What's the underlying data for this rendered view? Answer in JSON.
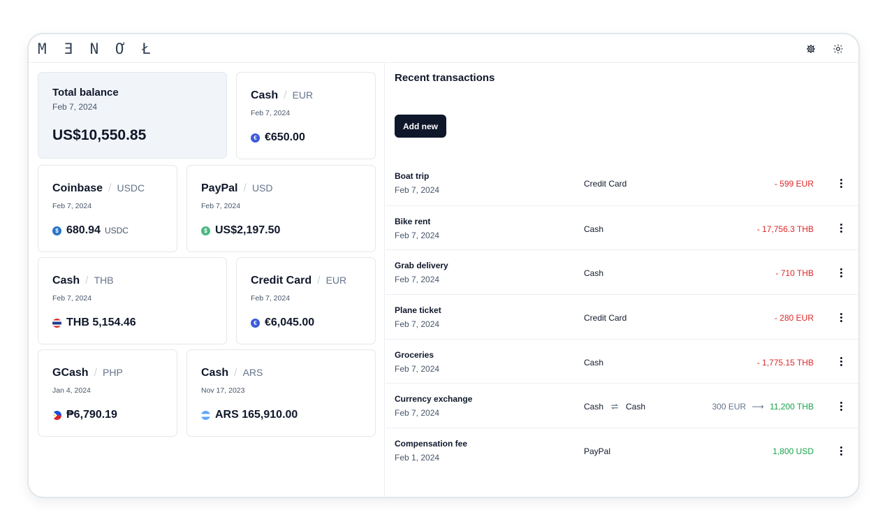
{
  "app": {
    "logo": "M Ǝ N Ơ Ł"
  },
  "header": {
    "settings_icon": "gear-icon",
    "theme_icon": "sun-icon"
  },
  "accounts": {
    "total": {
      "title": "Total balance",
      "date": "Feb 7, 2024",
      "amount": "US$10,550.85"
    },
    "cash_eur": {
      "name": "Cash",
      "currency": "EUR",
      "date": "Feb 7, 2024",
      "amount": "€650.00",
      "icon": "euro-icon",
      "icon_color": "#3b5bdb"
    },
    "coinbase": {
      "name": "Coinbase",
      "currency": "USDC",
      "date": "Feb 7, 2024",
      "amount": "680.94",
      "unit": "USDC",
      "icon": "usdc-icon",
      "icon_color": "#2775ca"
    },
    "paypal": {
      "name": "PayPal",
      "currency": "USD",
      "date": "Feb 7, 2024",
      "amount": "US$2,197.50",
      "icon": "dollar-icon",
      "icon_color": "#4cb782"
    },
    "cash_thb": {
      "name": "Cash",
      "currency": "THB",
      "date": "Feb 7, 2024",
      "amount": "THB 5,154.46",
      "icon": "thailand-flag-icon"
    },
    "credit_card": {
      "name": "Credit Card",
      "currency": "EUR",
      "date": "Feb 7, 2024",
      "amount": "€6,045.00",
      "icon": "euro-icon",
      "icon_color": "#3b5bdb"
    },
    "gcash": {
      "name": "GCash",
      "currency": "PHP",
      "date": "Jan 4, 2024",
      "amount": "₱6,790.19",
      "icon": "philippines-flag-icon"
    },
    "cash_ars": {
      "name": "Cash",
      "currency": "ARS",
      "date": "Nov 17, 2023",
      "amount": "ARS 165,910.00",
      "icon": "argentina-flag-icon"
    }
  },
  "transactions": {
    "title": "Recent transactions",
    "add_label": "Add new",
    "rows": [
      {
        "name": "Boat trip",
        "date": "Feb 7, 2024",
        "account": "Credit Card",
        "amount": "- 599 EUR",
        "kind": "neg"
      },
      {
        "name": "Bike rent",
        "date": "Feb 7, 2024",
        "account": "Cash",
        "amount": "- 17,756.3 THB",
        "kind": "neg"
      },
      {
        "name": "Grab delivery",
        "date": "Feb 7, 2024",
        "account": "Cash",
        "amount": "- 710 THB",
        "kind": "neg"
      },
      {
        "name": "Plane ticket",
        "date": "Feb 7, 2024",
        "account": "Credit Card",
        "amount": "- 280 EUR",
        "kind": "neg"
      },
      {
        "name": "Groceries",
        "date": "Feb 7, 2024",
        "account": "Cash",
        "amount": "- 1,775.15 THB",
        "kind": "neg"
      },
      {
        "name": "Currency exchange",
        "date": "Feb 7, 2024",
        "account": "Cash",
        "account_to": "Cash",
        "amount_from": "300 EUR",
        "amount": "11,200 THB",
        "kind": "exchange"
      },
      {
        "name": "Compensation fee",
        "date": "Feb 1, 2024",
        "account": "PayPal",
        "amount": "1,800 USD",
        "kind": "pos"
      }
    ]
  },
  "colors": {
    "negative": "#dc2626",
    "positive": "#16a34a",
    "primary_button": "#0f172a"
  }
}
